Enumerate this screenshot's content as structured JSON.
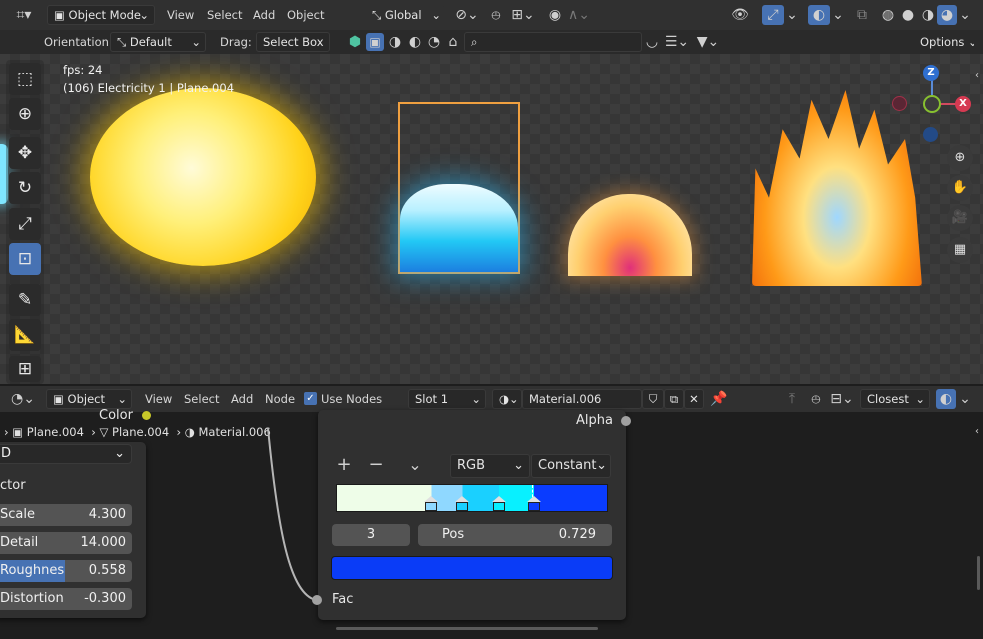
{
  "header": {
    "editor_icon": "viewport-editor-icon",
    "mode": "Object Mode",
    "menu": [
      "View",
      "Select",
      "Add",
      "Object"
    ],
    "orientation_transform": "Global"
  },
  "toolbar2": {
    "orientation_label": "Orientation:",
    "orientation_value": "Default",
    "drag_label": "Drag:",
    "drag_value": "Select Box",
    "options": "Options"
  },
  "viewport": {
    "fps": "fps: 24",
    "object_info": "(106) Electricity 1 | Plane.004",
    "axis_x": "X",
    "axis_z": "Z"
  },
  "node_header": {
    "type": "Object",
    "menu": [
      "View",
      "Select",
      "Add",
      "Node"
    ],
    "use_nodes_label": "Use Nodes",
    "use_nodes": true,
    "slot": "Slot 1",
    "material": "Material.006",
    "interpolation": "Closest"
  },
  "breadcrumb": [
    "Plane.004",
    "Plane.004",
    "Material.006"
  ],
  "left_node": {
    "color_socket": "Color",
    "dimension": "D",
    "section": "ctor",
    "fields": [
      {
        "label": "Scale",
        "value": "4.300"
      },
      {
        "label": "Detail",
        "value": "14.000"
      },
      {
        "label": "Roughnes",
        "value": "0.558"
      },
      {
        "label": "Distortion",
        "value": "-0.300"
      }
    ],
    "roughness_fill": 0.558
  },
  "color_ramp": {
    "alpha_label": "Alpha",
    "color_mode": "RGB",
    "interpolation": "Constant",
    "active_index": "3",
    "pos_label": "Pos",
    "pos_value": "0.729",
    "fac_label": "Fac",
    "stops": [
      {
        "pos": 0.0,
        "color": "#eefde8"
      },
      {
        "pos": 0.35,
        "color": "#8fd8ff"
      },
      {
        "pos": 0.465,
        "color": "#1ad0ff"
      },
      {
        "pos": 0.6,
        "color": "#08f0ff"
      },
      {
        "pos": 0.729,
        "color": "#0a3cff"
      }
    ],
    "selected_color": "#0a3cf7"
  },
  "colors": {
    "accent": "#4772b3",
    "socket_yellow": "#c7c729",
    "socket_gray": "#a1a1a1"
  }
}
